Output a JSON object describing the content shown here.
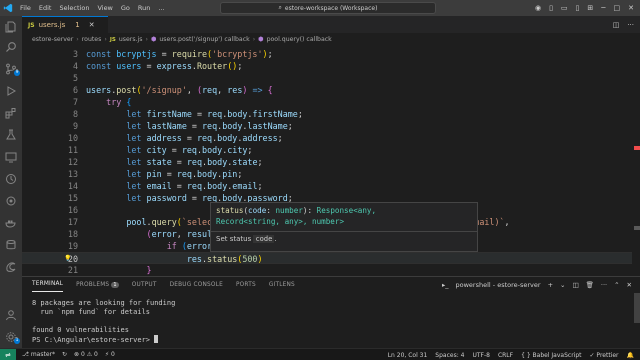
{
  "titlebar": {
    "menu": [
      "File",
      "Edit",
      "Selection",
      "View",
      "Go",
      "Run",
      "..."
    ],
    "back_icon": "arrow-left-icon",
    "forward_icon": "arrow-right-icon",
    "search_text": "estore-workspace (Workspace)"
  },
  "tab": {
    "badge": "JS",
    "name": "users.js",
    "number": "1"
  },
  "breadcrumb": [
    "estore-server",
    "routes",
    "users.js",
    "users.post('/signup') callback",
    "pool.query() callback"
  ],
  "editor": {
    "lines": [
      {
        "num": "3",
        "html": "<span class='k'>const</span> <span class='cn'>bcryptjs</span> <span class='p'>=</span> <span class='f'>require</span><span class='br1'>(</span><span class='s'>'bcryptjs'</span><span class='br1'>)</span><span class='p'>;</span>"
      },
      {
        "num": "4",
        "html": "<span class='k'>const</span> <span class='cn'>users</span> <span class='p'>=</span> <span class='v'>express</span><span class='p'>.</span><span class='f'>Router</span><span class='br1'>()</span><span class='p'>;</span>"
      },
      {
        "num": "5",
        "html": ""
      },
      {
        "num": "6",
        "html": "<span class='v'>users</span><span class='p'>.</span><span class='f'>post</span><span class='br1'>(</span><span class='s'>'/signup'</span><span class='p'>, </span><span class='br2'>(</span><span class='v'>req</span><span class='p'>, </span><span class='v'>res</span><span class='br2'>)</span> <span class='k'>=&gt;</span> <span class='br2'>{</span>"
      },
      {
        "num": "7",
        "html": "    <span class='c'>try</span> <span class='br3'>{</span>"
      },
      {
        "num": "8",
        "html": "        <span class='k'>let</span> <span class='v'>firstName</span> <span class='p'>=</span> <span class='v'>req</span><span class='p'>.</span><span class='v'>body</span><span class='p'>.</span><span class='v'>firstName</span><span class='p'>;</span>"
      },
      {
        "num": "9",
        "html": "        <span class='k'>let</span> <span class='v'>lastName</span> <span class='p'>=</span> <span class='v'>req</span><span class='p'>.</span><span class='v'>body</span><span class='p'>.</span><span class='v'>lastName</span><span class='p'>;</span>"
      },
      {
        "num": "10",
        "html": "        <span class='k'>let</span> <span class='v'>address</span> <span class='p'>=</span> <span class='v'>req</span><span class='p'>.</span><span class='v'>body</span><span class='p'>.</span><span class='v'>address</span><span class='p'>;</span>"
      },
      {
        "num": "11",
        "html": "        <span class='k'>let</span> <span class='v'>city</span> <span class='p'>=</span> <span class='v'>req</span><span class='p'>.</span><span class='v'>body</span><span class='p'>.</span><span class='v'>city</span><span class='p'>;</span>"
      },
      {
        "num": "12",
        "html": "        <span class='k'>let</span> <span class='v'>state</span> <span class='p'>=</span> <span class='v'>req</span><span class='p'>.</span><span class='v'>body</span><span class='p'>.</span><span class='v'>state</span><span class='p'>;</span>"
      },
      {
        "num": "13",
        "html": "        <span class='k'>let</span> <span class='v'>pin</span> <span class='p'>=</span> <span class='v'>req</span><span class='p'>.</span><span class='v'>body</span><span class='p'>.</span><span class='v'>pin</span><span class='p'>;</span>"
      },
      {
        "num": "14",
        "html": "        <span class='k'>let</span> <span class='v'>email</span> <span class='p'>=</span> <span class='v'>req</span><span class='p'>.</span><span class='v'>body</span><span class='p'>.</span><span class='v'>email</span><span class='p'>;</span>"
      },
      {
        "num": "15",
        "html": "        <span class='k'>let</span> <span class='v'>password</span> <span class='p'>=</span> <span class='v'>req</span><span class='p'>.</span><span class='v'>body</span><span class='p'>.</span><span class='v'>password</span><span class='p'>;</span>"
      },
      {
        "num": "16",
        "html": ""
      },
      {
        "num": "17",
        "html": "        <span class='v'>pool</span><span class='p'>.</span><span class='f'>query</span><span class='br1'>(</span><span class='s'>`select cou</span>                                            <span class='s'>S(email)`</span><span class='p'>,</span>"
      },
      {
        "num": "18",
        "html": "            <span class='br2'>(</span><span class='v'>error</span><span class='p'>, </span><span class='v'>resultCoun</span>"
      },
      {
        "num": "19",
        "html": "                <span class='c'>if</span> <span class='br3'>(</span><span class='v'>error</span><span class='br3'>)</span> <span class='br3'>{</span>"
      },
      {
        "num": "20",
        "html": "                    <span class='v'>res</span><span class='p'>.</span><span class='f'>status</span><span class='br1'>(</span><span class='n'>500</span><span class='br1'>)</span>"
      },
      {
        "num": "21",
        "html": "            <span class='br2'>}</span>"
      }
    ],
    "current_line": "20"
  },
  "hover": {
    "fn": "status",
    "param": "code",
    "param_type": "number",
    "ret1": "Response<any,",
    "ret2": "Record<string, any>, number>",
    "doc_pre": "Set status",
    "doc_code": "code",
    "doc_post": "."
  },
  "panel": {
    "tabs": [
      "TERMINAL",
      "PROBLEMS",
      "OUTPUT",
      "DEBUG CONSOLE",
      "PORTS",
      "GITLENS"
    ],
    "problems_count": "1",
    "terminal_name": "powershell - estore-server",
    "terminal_lines": [
      "8 packages are looking for funding",
      "  run `npm fund` for details",
      "",
      "found 0 vulnerabilities",
      "PS C:\\Angular\\estore-server> "
    ]
  },
  "status": {
    "branch": "master*",
    "sync": "↻",
    "errors": "0",
    "warnings": "0",
    "ports": "0",
    "position": "Ln 20, Col 31",
    "spaces": "Spaces: 4",
    "encoding": "UTF-8",
    "eol": "CRLF",
    "language": "{ } Babel JavaScript",
    "formatter": "✓ Prettier"
  }
}
